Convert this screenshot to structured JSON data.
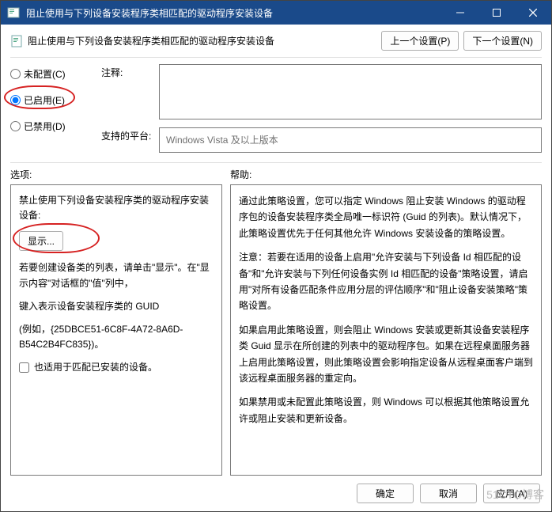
{
  "window": {
    "title": "阻止使用与下列设备安装程序类相匹配的驱动程序安装设备"
  },
  "header": {
    "label": "阻止使用与下列设备安装程序类相匹配的驱动程序安装设备",
    "prev_btn": "上一个设置(P)",
    "next_btn": "下一个设置(N)"
  },
  "radios": {
    "not_configured": "未配置(C)",
    "enabled": "已启用(E)",
    "disabled": "已禁用(D)"
  },
  "meta": {
    "comment_label": "注释:",
    "platform_label": "支持的平台:",
    "platform_value": "Windows Vista 及以上版本"
  },
  "section_labels": {
    "options": "选项:",
    "help": "帮助:"
  },
  "options": {
    "p1": "禁止使用下列设备安装程序类的驱动程序安装设备:",
    "show_btn": "显示...",
    "p2": "若要创建设备类的列表，请单击\"显示\"。在\"显示内容\"对话框的\"值\"列中，",
    "p3": "键入表示设备安装程序类的 GUID",
    "p4": "(例如，{25DBCE51-6C8F-4A72-8A6D-B54C2B4FC835})。",
    "checkbox_label": "也适用于匹配已安装的设备。"
  },
  "help": {
    "p1": "通过此策略设置，您可以指定 Windows 阻止安装 Windows 的驱动程序包的设备安装程序类全局唯一标识符 (Guid 的列表)。默认情况下，此策略设置优先于任何其他允许 Windows 安装设备的策略设置。",
    "p2": "注意：若要在适用的设备上启用\"允许安装与下列设备 Id 相匹配的设备\"和\"允许安装与下列任何设备实例 Id 相匹配的设备\"策略设置，请启用\"对所有设备匹配条件应用分层的评估顺序\"和\"阻止设备安装策略\"策略设置。",
    "p3": "如果启用此策略设置，则会阻止 Windows 安装或更新其设备安装程序类 Guid 显示在所创建的列表中的驱动程序包。如果在远程桌面服务器上启用此策略设置，则此策略设置会影响指定设备从远程桌面客户端到该远程桌面服务器的重定向。",
    "p4": "如果禁用或未配置此策略设置，则 Windows 可以根据其他策略设置允许或阻止安装和更新设备。"
  },
  "footer": {
    "ok": "确定",
    "cancel": "取消",
    "apply": "应用(A)"
  },
  "watermark": "51CTO博客"
}
